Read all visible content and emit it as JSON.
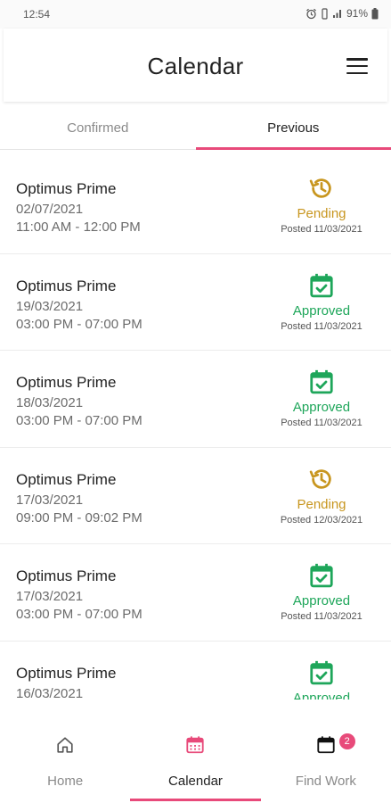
{
  "status_bar": {
    "time": "12:54",
    "battery": "91%"
  },
  "header": {
    "title": "Calendar"
  },
  "tabs": [
    {
      "label": "Confirmed",
      "active": false
    },
    {
      "label": "Previous",
      "active": true
    }
  ],
  "colors": {
    "accent": "#e84a7a",
    "pending": "#c8961f",
    "approved": "#1ea65a"
  },
  "bookings": [
    {
      "name": "Optimus Prime",
      "date": "02/07/2021",
      "time": "11:00 AM - 12:00 PM",
      "status": "Pending",
      "status_icon": "history-icon",
      "posted": "Posted 11/03/2021"
    },
    {
      "name": "Optimus Prime",
      "date": "19/03/2021",
      "time": "03:00 PM - 07:00 PM",
      "status": "Approved",
      "status_icon": "calendar-check-icon",
      "posted": "Posted 11/03/2021"
    },
    {
      "name": "Optimus Prime",
      "date": "18/03/2021",
      "time": "03:00 PM - 07:00 PM",
      "status": "Approved",
      "status_icon": "calendar-check-icon",
      "posted": "Posted 11/03/2021"
    },
    {
      "name": "Optimus Prime",
      "date": "17/03/2021",
      "time": "09:00 PM - 09:02 PM",
      "status": "Pending",
      "status_icon": "history-icon",
      "posted": "Posted 12/03/2021"
    },
    {
      "name": "Optimus Prime",
      "date": "17/03/2021",
      "time": "03:00 PM - 07:00 PM",
      "status": "Approved",
      "status_icon": "calendar-check-icon",
      "posted": "Posted 11/03/2021"
    },
    {
      "name": "Optimus Prime",
      "date": "16/03/2021",
      "time": "",
      "status": "Approved",
      "status_icon": "calendar-check-icon",
      "posted": ""
    }
  ],
  "bottom_nav": {
    "home": {
      "label": "Home",
      "icon": "home-icon"
    },
    "calendar": {
      "label": "Calendar",
      "icon": "calendar-icon"
    },
    "find_work": {
      "label": "Find Work",
      "icon": "calendar-icon",
      "badge": "2"
    }
  }
}
